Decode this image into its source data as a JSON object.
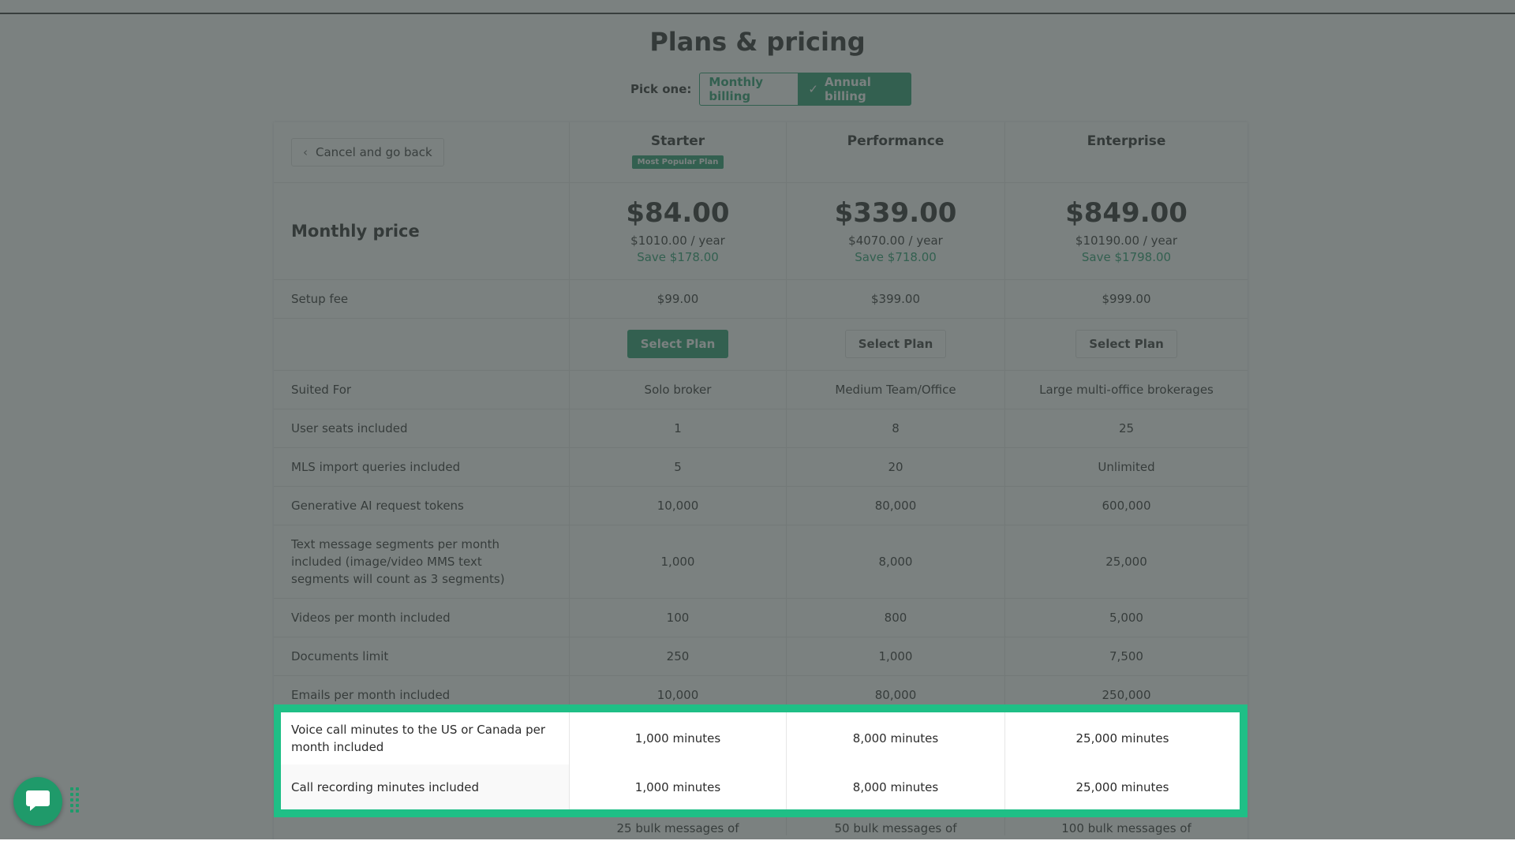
{
  "page": {
    "title": "Plans & pricing"
  },
  "billing": {
    "pick_label": "Pick one:",
    "monthly_label": "Monthly billing",
    "annual_label": "Annual billing",
    "selected": "Annual billing"
  },
  "header": {
    "back_label": "Cancel and go back",
    "plans": [
      {
        "name": "Starter",
        "badge": "Most Popular Plan"
      },
      {
        "name": "Performance",
        "badge": ""
      },
      {
        "name": "Enterprise",
        "badge": ""
      }
    ]
  },
  "pricing": {
    "label": "Monthly price",
    "plans": [
      {
        "price": "$84.00",
        "year": "$1010.00 / year",
        "save": "Save $178.00"
      },
      {
        "price": "$339.00",
        "year": "$4070.00 / year",
        "save": "Save $718.00"
      },
      {
        "price": "$849.00",
        "year": "$10190.00 / year",
        "save": "Save $1798.00"
      }
    ]
  },
  "setup": {
    "label": "Setup fee",
    "values": [
      "$99.00",
      "$399.00",
      "$999.00"
    ]
  },
  "select_buttons": [
    "Select Plan",
    "Select Plan",
    "Select Plan"
  ],
  "features": [
    {
      "label": "Suited For",
      "values": [
        "Solo broker",
        "Medium Team/Office",
        "Large multi-office brokerages"
      ]
    },
    {
      "label": "User seats included",
      "values": [
        "1",
        "8",
        "25"
      ]
    },
    {
      "label": "MLS import queries included",
      "values": [
        "5",
        "20",
        "Unlimited"
      ]
    },
    {
      "label": "Generative AI request tokens",
      "values": [
        "10,000",
        "80,000",
        "600,000"
      ]
    },
    {
      "label": "Text message segments per month included (image/video MMS text segments will count as 3 segments)",
      "values": [
        "1,000",
        "8,000",
        "25,000"
      ]
    },
    {
      "label": "Videos per month included",
      "values": [
        "100",
        "800",
        "5,000"
      ]
    },
    {
      "label": "Documents limit",
      "values": [
        "250",
        "1,000",
        "7,500"
      ]
    },
    {
      "label": "Emails per month included",
      "values": [
        "10,000",
        "80,000",
        "250,000"
      ]
    }
  ],
  "highlighted": [
    {
      "label": "Voice call minutes to the US or Canada per month included",
      "values": [
        "1,000 minutes",
        "8,000 minutes",
        "25,000 minutes"
      ]
    },
    {
      "label": "Call recording minutes included",
      "values": [
        "1,000 minutes",
        "8,000 minutes",
        "25,000 minutes"
      ]
    }
  ],
  "partial_row": {
    "values": [
      "25 bulk messages of",
      "50 bulk messages of",
      "100 bulk messages of"
    ]
  },
  "colors": {
    "accent": "#1f9a6a",
    "highlight": "#1fbf86",
    "overlay": "#3c4644"
  },
  "icons": {
    "chat": "chat-bubble-icon",
    "back": "chevron-left-icon",
    "check": "check-icon",
    "handle": "drag-handle-icon"
  }
}
